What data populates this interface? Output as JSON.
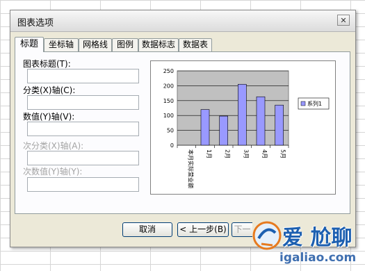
{
  "dialog": {
    "title": "图表选项",
    "close_glyph": "✕",
    "tabs": [
      {
        "label": "标题",
        "active": true
      },
      {
        "label": "坐标轴",
        "active": false
      },
      {
        "label": "网格线",
        "active": false
      },
      {
        "label": "图例",
        "active": false
      },
      {
        "label": "数据标志",
        "active": false
      },
      {
        "label": "数据表",
        "active": false
      }
    ],
    "fields": [
      {
        "label": "图表标题(T):",
        "value": "",
        "enabled": true
      },
      {
        "label": "分类(X)轴(C):",
        "value": "",
        "enabled": true
      },
      {
        "label": "数值(Y)轴(V):",
        "value": "",
        "enabled": true
      },
      {
        "label": "次分类(X)轴(A):",
        "value": "",
        "enabled": false
      },
      {
        "label": "次数值(Y)轴(Y):",
        "value": "",
        "enabled": false
      }
    ],
    "buttons": {
      "cancel": "取消",
      "back": "< 上一步(B)",
      "next": "下一"
    }
  },
  "chart_data": {
    "type": "bar",
    "categories": [
      "1月",
      "2月",
      "3月",
      "4月",
      "5月"
    ],
    "x_first_tick_label": "本月实际营业额",
    "series": [
      {
        "name": "系列1",
        "values": [
          120,
          98,
          205,
          163,
          135
        ]
      }
    ],
    "ylim": [
      0,
      250
    ],
    "yticks": [
      0,
      50,
      100,
      150,
      200,
      250
    ],
    "grid": true,
    "legend": "right",
    "colors": {
      "bar": "#9999ff",
      "plot_bg": "#c0c0c0"
    }
  },
  "watermark": {
    "text": "爱 尬聊",
    "url": "igaliao.com",
    "color": "#1c5fb0"
  }
}
